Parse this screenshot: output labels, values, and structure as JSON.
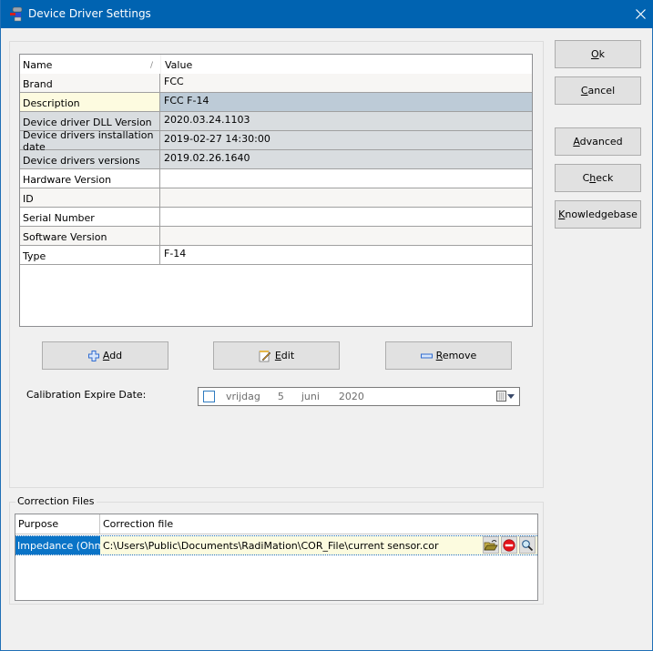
{
  "window": {
    "title": "Device Driver Settings",
    "close_label": "×"
  },
  "properties": {
    "header": {
      "name": "Name",
      "sort_indicator": "/",
      "value": "Value"
    },
    "rows": [
      {
        "name": "Brand",
        "value": "FCC"
      },
      {
        "name": "Description",
        "value": "FCC F-14"
      },
      {
        "name": "Device driver DLL Version",
        "value": "2020.03.24.1103"
      },
      {
        "name": "Device drivers installation date",
        "value": "2019-02-27 14:30:00"
      },
      {
        "name": "Device drivers versions",
        "value": "2019.02.26.1640"
      },
      {
        "name": "Hardware Version",
        "value": ""
      },
      {
        "name": "ID",
        "value": ""
      },
      {
        "name": "Serial Number",
        "value": ""
      },
      {
        "name": "Software Version",
        "value": ""
      },
      {
        "name": "Type",
        "value": "F-14"
      }
    ]
  },
  "grid_buttons": {
    "add": {
      "accel": "A",
      "rest": "dd"
    },
    "edit": {
      "accel": "E",
      "rest": "dit"
    },
    "remove": {
      "accel": "R",
      "rest": "emove"
    }
  },
  "calibration": {
    "label": "Calibration Expire Date:",
    "checked": false,
    "weekday": "vrijdag",
    "day": "5",
    "month": "juni",
    "year": "2020"
  },
  "side_buttons": {
    "ok": {
      "pre": "",
      "accel": "O",
      "rest": "k"
    },
    "cancel": {
      "pre": "",
      "accel": "C",
      "rest": "ancel"
    },
    "advanced": {
      "pre": "",
      "accel": "A",
      "rest": "dvanced"
    },
    "check": {
      "pre": "C",
      "accel": "h",
      "rest": "eck"
    },
    "knowledgebase": {
      "pre": "",
      "accel": "K",
      "rest": "nowledgebase"
    }
  },
  "correction_files": {
    "group_label": "Correction Files",
    "columns": {
      "purpose": "Purpose",
      "file": "Correction file"
    },
    "rows": [
      {
        "purpose": "Impedance (Ohm)",
        "file": "C:\\Users\\Public\\Documents\\RadiMation\\COR_File\\current sensor.cor"
      }
    ]
  },
  "colors": {
    "titlebar": "#0063b1",
    "selection": "#0a74c7",
    "description_highlight": "#bdcbd7"
  }
}
